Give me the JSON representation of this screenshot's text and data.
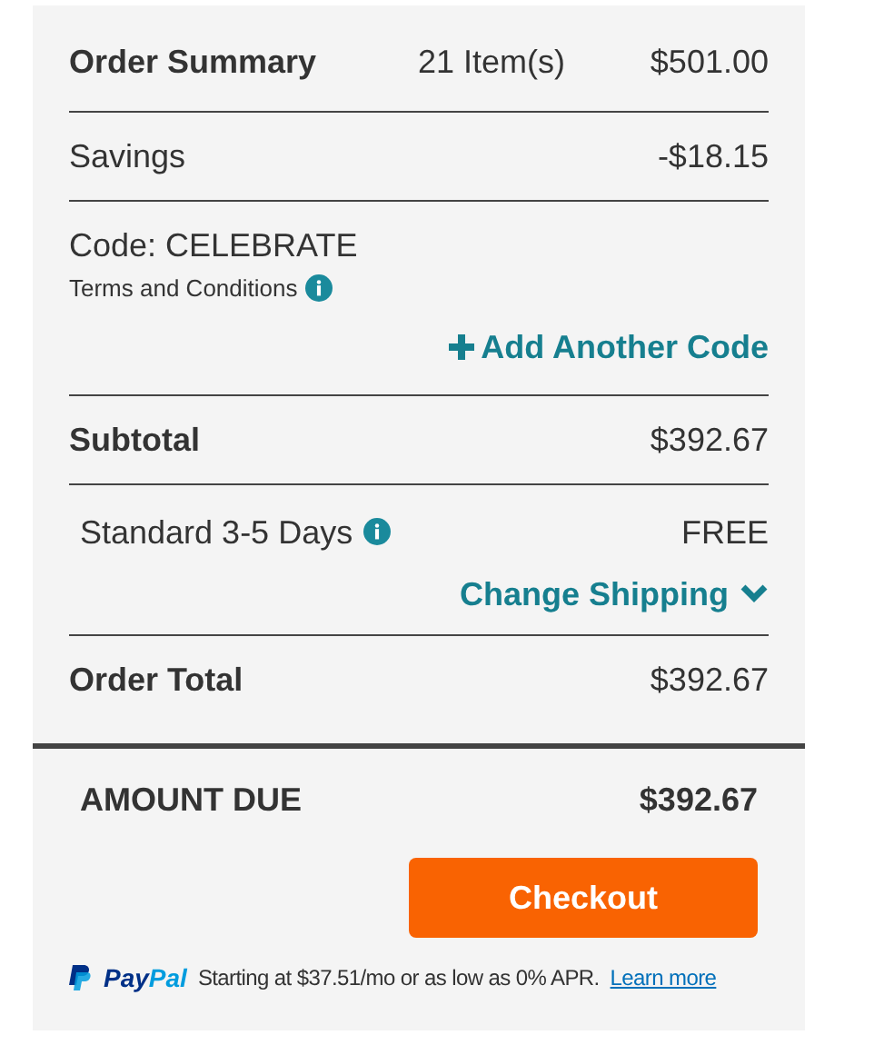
{
  "summary": {
    "title": "Order Summary",
    "items": "21 Item(s)",
    "amount": "$501.00"
  },
  "savings": {
    "label": "Savings",
    "amount": "-$18.15"
  },
  "promo": {
    "code": "Code: CELEBRATE",
    "terms": "Terms and Conditions",
    "add_code": "Add Another Code"
  },
  "subtotal": {
    "label": "Subtotal",
    "amount": "$392.67"
  },
  "shipping": {
    "method": "Standard 3-5 Days",
    "price": "FREE",
    "change": "Change Shipping"
  },
  "order_total": {
    "label": "Order Total",
    "amount": "$392.67"
  },
  "amount_due": {
    "label": "AMOUNT DUE",
    "amount": "$392.67"
  },
  "checkout": "Checkout",
  "paypal": {
    "brand_first": "Pay",
    "brand_second": "Pal",
    "text": "Starting at $37.51/mo or as low as 0% APR.",
    "link": "Learn more"
  }
}
